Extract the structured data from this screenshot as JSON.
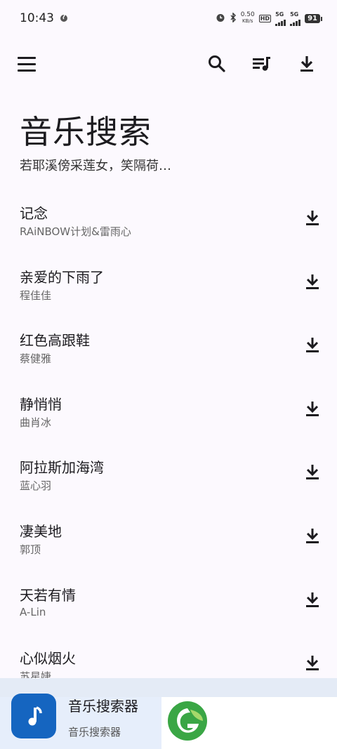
{
  "status_bar": {
    "time": "10:43",
    "net_speed_value": "0.50",
    "net_speed_unit": "KB/s",
    "hd_label": "HD",
    "sim1_label": "5G",
    "sim2_label": "5G",
    "battery": "91"
  },
  "header": {
    "title": "音乐搜索",
    "subtitle": "若耶溪傍采莲女，笑隔荷…"
  },
  "songs": [
    {
      "title": "记念",
      "artist": "RAiNBOW计划&雷雨心"
    },
    {
      "title": "亲爱的下雨了",
      "artist": "程佳佳"
    },
    {
      "title": "红色高跟鞋",
      "artist": "蔡健雅"
    },
    {
      "title": "静悄悄",
      "artist": "曲肖冰"
    },
    {
      "title": "阿拉斯加海湾",
      "artist": "蓝心羽"
    },
    {
      "title": "凄美地",
      "artist": "郭顶"
    },
    {
      "title": "天若有情",
      "artist": "A-Lin"
    },
    {
      "title": "心似烟火",
      "artist": "苏星婕"
    }
  ],
  "app_card": {
    "name": "音乐搜索器",
    "subtitle": "音乐搜索器"
  },
  "colors": {
    "background": "#fcf9fe",
    "app_icon": "#1565c0",
    "logo_green": "#3aa645"
  }
}
